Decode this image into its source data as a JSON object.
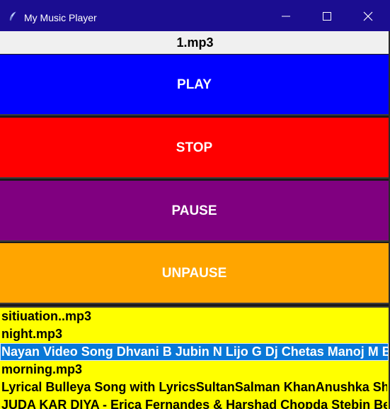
{
  "window": {
    "title": "My Music Player",
    "icon": "feather-icon"
  },
  "current_song": "1.mp3",
  "controls": {
    "play": {
      "label": "PLAY",
      "color": "#0000ff"
    },
    "stop": {
      "label": "STOP",
      "color": "#ff0000"
    },
    "pause": {
      "label": "PAUSE",
      "color": "#800080"
    },
    "unpause": {
      "label": "UNPAUSE",
      "color": "#ffa500"
    }
  },
  "playlist": {
    "background": "#ffff00",
    "items": [
      {
        "label": "sitiuation..mp3",
        "selected": false
      },
      {
        "label": "night.mp3",
        "selected": false
      },
      {
        "label": "Nayan Video Song Dhvani B Jubin N Lijo G Dj Chetas Manoj M Bhushan K Radhika R",
        "selected": true
      },
      {
        "label": "morning.mp3",
        "selected": false
      },
      {
        "label": "Lyrical Bulleya Song with LyricsSultanSalman KhanAnushka Sharma",
        "selected": false
      },
      {
        "label": "JUDA KAR DIYA - Erica Fernandes & Harshad Chopda Stebin Ben",
        "selected": false
      }
    ]
  }
}
